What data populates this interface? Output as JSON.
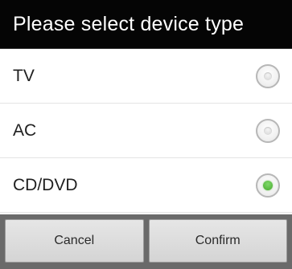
{
  "dialog": {
    "title": "Please select device type",
    "options": [
      {
        "label": "TV",
        "selected": false
      },
      {
        "label": "AC",
        "selected": false
      },
      {
        "label": "CD/DVD",
        "selected": true
      }
    ],
    "buttons": {
      "cancel_label": "Cancel",
      "confirm_label": "Confirm"
    }
  },
  "colors": {
    "title_bar_bg": "#050505",
    "selected_radio": "#58b83f",
    "button_bar_bg": "#6a6a6a"
  }
}
